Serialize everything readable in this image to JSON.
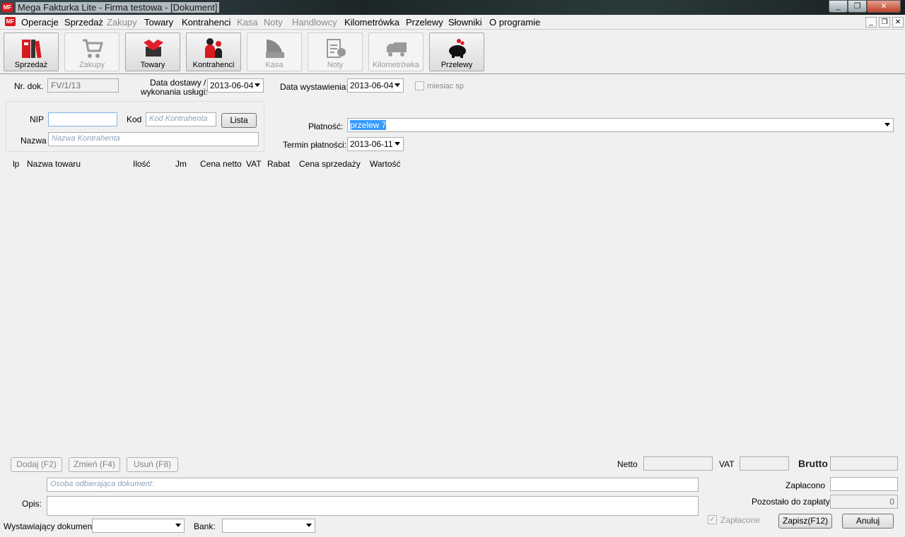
{
  "window": {
    "title": "Mega Fakturka Lite - Firma testowa - [Dokument]",
    "logo": "MF"
  },
  "menu": [
    {
      "label": "Operacje",
      "enabled": true
    },
    {
      "label": "Sprzedaż",
      "enabled": true
    },
    {
      "label": "Zakupy",
      "enabled": false
    },
    {
      "label": "Towary",
      "enabled": true
    },
    {
      "label": "Kontrahenci",
      "enabled": true
    },
    {
      "label": "Kasa",
      "enabled": false
    },
    {
      "label": "Noty",
      "enabled": false
    },
    {
      "label": "Handlowcy",
      "enabled": false
    },
    {
      "label": "Kilometrówka",
      "enabled": true
    },
    {
      "label": "Przelewy",
      "enabled": true
    },
    {
      "label": "Słowniki",
      "enabled": true
    },
    {
      "label": "O programie",
      "enabled": true
    }
  ],
  "toolbar": [
    {
      "label": "Sprzedaż",
      "icon": "binders-icon",
      "enabled": true
    },
    {
      "label": "Zakupy",
      "icon": "cart-icon",
      "enabled": false
    },
    {
      "label": "Towary",
      "icon": "box-icon",
      "enabled": true
    },
    {
      "label": "Kontrahenci",
      "icon": "people-icon",
      "enabled": true
    },
    {
      "label": "Kasa",
      "icon": "cash-register-icon",
      "enabled": false
    },
    {
      "label": "Noty",
      "icon": "clipboard-icon",
      "enabled": false
    },
    {
      "label": "Kilometrówka",
      "icon": "truck-icon",
      "enabled": false
    },
    {
      "label": "Przelewy",
      "icon": "piggy-bank-icon",
      "enabled": true
    }
  ],
  "form": {
    "nr_dok_label": "Nr. dok.",
    "nr_dok_value": "FV/1/13",
    "data_dostawy_label1": "Data dostawy /",
    "data_dostawy_label2": "wykonania usługi:",
    "data_dostawy_value": "2013-06-04",
    "data_wyst_label": "Data wystawienia:",
    "data_wyst_value": "2013-06-04",
    "miesiac_label": "miesiac sp",
    "nip_label": "NIP",
    "nip_value": "",
    "kod_label": "Kod",
    "kod_placeholder": "Kod Kontrahenta",
    "lista_button": "Lista",
    "nazwa_label": "Nazwa",
    "nazwa_placeholder": "Nazwa Kontrahenta",
    "platnosc_label": "Płatność:",
    "platnosc_value": "przelew 7",
    "termin_label": "Termin płatności:",
    "termin_value": "2013-06-11"
  },
  "table": {
    "columns": [
      "lp",
      "Nazwa towaru",
      "Ilość",
      "Jm",
      "Cena netto",
      "VAT",
      "Rabat",
      "Cena sprzedaży",
      "Wartość"
    ],
    "rows": []
  },
  "actions": {
    "dodaj": "Dodaj (F2)",
    "zmien": "Zmień (F4)",
    "usun": "Usuń (F8)"
  },
  "totals": {
    "netto_label": "Netto",
    "vat_label": "VAT",
    "brutto_label": "Brutto",
    "zaplacono_label": "Zapłacono",
    "pozostalo_label": "Pozostało do zapłaty",
    "pozostalo_value": "0",
    "zaplacone_label": "Zapłacone",
    "zaplacone_checked": true
  },
  "bottom": {
    "osoba_placeholder": "Osoba odbierająca dokument:",
    "opis_label": "Opis:",
    "wystawiajacy_label": "Wystawiający dokument",
    "bank_label": "Bank:",
    "zapisz": "Zapisz(F12)",
    "anuluj": "Anuluj"
  },
  "colors": {
    "brand": "#d71920",
    "selection": "#3399ff"
  }
}
